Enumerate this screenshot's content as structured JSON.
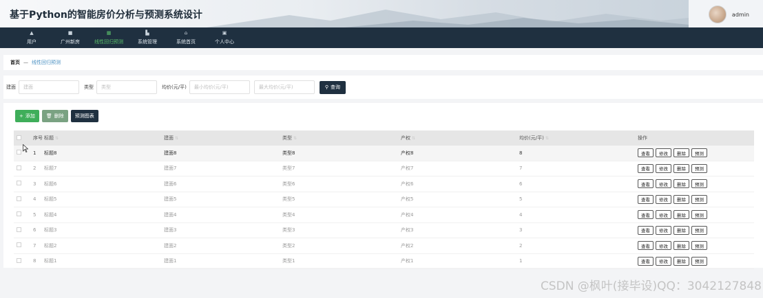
{
  "header": {
    "title": "基于Python的智能房价分析与预测系统设计",
    "username": "admin"
  },
  "nav": [
    {
      "label": "用户",
      "icon": "user-icon"
    },
    {
      "label": "广州新房",
      "icon": "house-icon"
    },
    {
      "label": "线性回归预测",
      "icon": "grid-icon",
      "active": true
    },
    {
      "label": "系统管理",
      "icon": "folder-icon"
    },
    {
      "label": "系统首页",
      "icon": "home-icon"
    },
    {
      "label": "个人中心",
      "icon": "profile-icon"
    }
  ],
  "breadcrumb": {
    "home": "首页",
    "separator": "—",
    "current": "线性回归预测"
  },
  "search": {
    "building_label": "建面",
    "building_placeholder": "建面",
    "type_label": "类型",
    "type_placeholder": "类型",
    "price_label": "均价(元/平)",
    "min_placeholder": "最小均价(元/平)",
    "max_placeholder": "最大均价(元/平)",
    "button": "查询"
  },
  "actions": {
    "add": "添加",
    "delete": "删除",
    "chart": "预测图表"
  },
  "table": {
    "headers": {
      "no": "序号",
      "title": "标题",
      "building": "建面",
      "type": "类型",
      "right": "产权",
      "price": "均价(元/平)",
      "ops": "操作"
    },
    "op_labels": [
      "查看",
      "修改",
      "删除",
      "预测"
    ],
    "rows": [
      {
        "no": "1",
        "title": "标题8",
        "building": "建面8",
        "type": "类型8",
        "right": "产权8",
        "price": "8"
      },
      {
        "no": "2",
        "title": "标题7",
        "building": "建面7",
        "type": "类型7",
        "right": "产权7",
        "price": "7"
      },
      {
        "no": "3",
        "title": "标题6",
        "building": "建面6",
        "type": "类型6",
        "right": "产权6",
        "price": "6"
      },
      {
        "no": "4",
        "title": "标题5",
        "building": "建面5",
        "type": "类型5",
        "right": "产权5",
        "price": "5"
      },
      {
        "no": "5",
        "title": "标题4",
        "building": "建面4",
        "type": "类型4",
        "right": "产权4",
        "price": "4"
      },
      {
        "no": "6",
        "title": "标题3",
        "building": "建面3",
        "type": "类型3",
        "right": "产权3",
        "price": "3"
      },
      {
        "no": "7",
        "title": "标题2",
        "building": "建面2",
        "type": "类型2",
        "right": "产权2",
        "price": "2"
      },
      {
        "no": "8",
        "title": "标题1",
        "building": "建面1",
        "type": "类型1",
        "right": "产权1",
        "price": "1"
      }
    ]
  },
  "watermark": "CSDN @枫叶(接毕设)QQ：3042127848",
  "colors": {
    "nav_bg": "#1f3040",
    "active": "#5bc06b",
    "add": "#3fae5a",
    "link": "#4a90c2"
  }
}
